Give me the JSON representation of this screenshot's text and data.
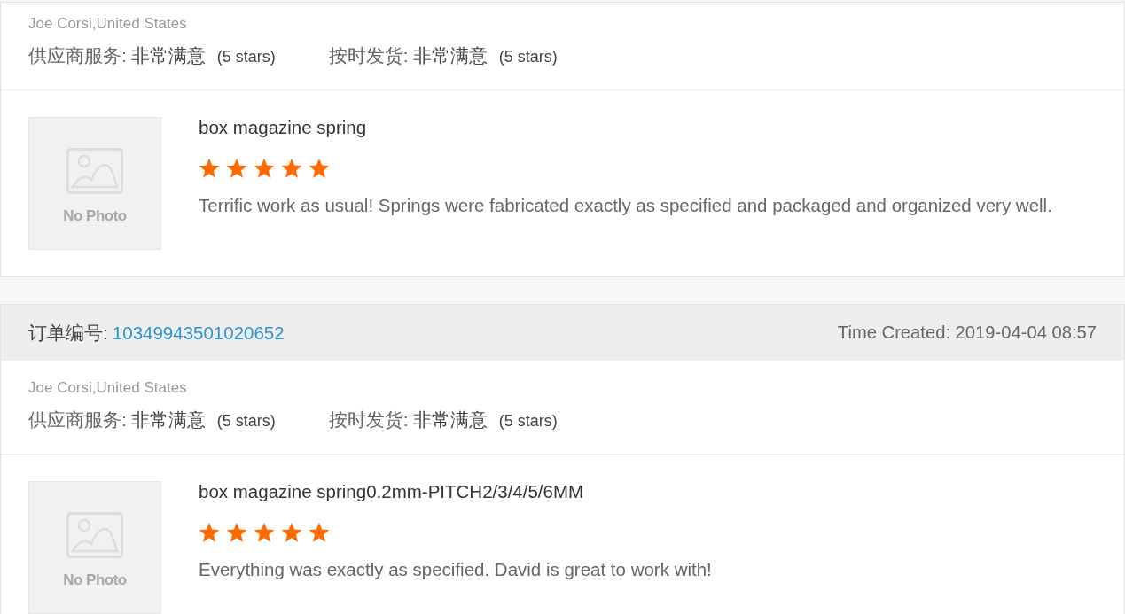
{
  "orders": [
    {
      "buyer": "Joe Corsi,United States",
      "ratings": [
        {
          "label": "供应商服务:",
          "value": "非常满意",
          "note": "(5 stars)"
        },
        {
          "label": "按时发货:",
          "value": "非常满意",
          "note": "(5 stars)"
        }
      ],
      "products": [
        {
          "photo_text": "No Photo",
          "name": "box magazine spring",
          "stars": 5,
          "comment": "Terrific work as usual! Springs were fabricated exactly as specified and packaged and organized very well."
        }
      ]
    },
    {
      "header": {
        "order_label": "订单编号:",
        "order_number": "10349943501020652",
        "time_created": "Time Created: 2019-04-04 08:57"
      },
      "buyer": "Joe Corsi,United States",
      "ratings": [
        {
          "label": "供应商服务:",
          "value": "非常满意",
          "note": "(5 stars)"
        },
        {
          "label": "按时发货:",
          "value": "非常满意",
          "note": "(5 stars)"
        }
      ],
      "products": [
        {
          "photo_text": "No Photo",
          "name": "box magazine spring0.2mm-PITCH2/3/4/5/6MM",
          "stars": 5,
          "comment": "Everything was exactly as specified. David is great to work with!"
        }
      ]
    }
  ]
}
